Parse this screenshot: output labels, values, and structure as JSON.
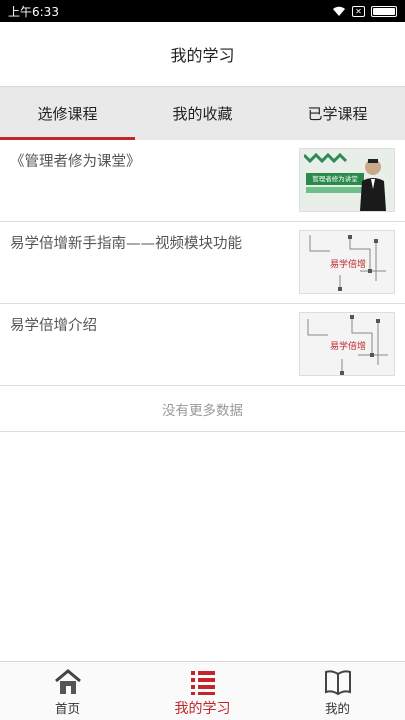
{
  "status_bar": {
    "time": "上午6:33",
    "sim_label": "✕"
  },
  "header": {
    "title": "我的学习"
  },
  "tabs": [
    {
      "label": "选修课程",
      "active": true
    },
    {
      "label": "我的收藏",
      "active": false
    },
    {
      "label": "已学课程",
      "active": false
    }
  ],
  "courses": [
    {
      "title": "《管理者修为课堂》",
      "thumb": {
        "banner": "管理者修为讲堂"
      }
    },
    {
      "title": "易学倍增新手指南——视频模块功能",
      "thumb": {
        "logo": "易学倍增"
      }
    },
    {
      "title": "易学倍增介绍",
      "thumb": {
        "logo": "易学倍增"
      }
    }
  ],
  "list_footer": {
    "text": "没有更多数据"
  },
  "bottom_nav": [
    {
      "label": "首页",
      "icon": "home-icon",
      "active": false
    },
    {
      "label": "我的学习",
      "icon": "list-icon",
      "active": true
    },
    {
      "label": "我的",
      "icon": "book-icon",
      "active": false
    }
  ],
  "colors": {
    "accent": "#c0262c",
    "tab_bg": "#e9e9e9",
    "divider": "#dddddd"
  }
}
